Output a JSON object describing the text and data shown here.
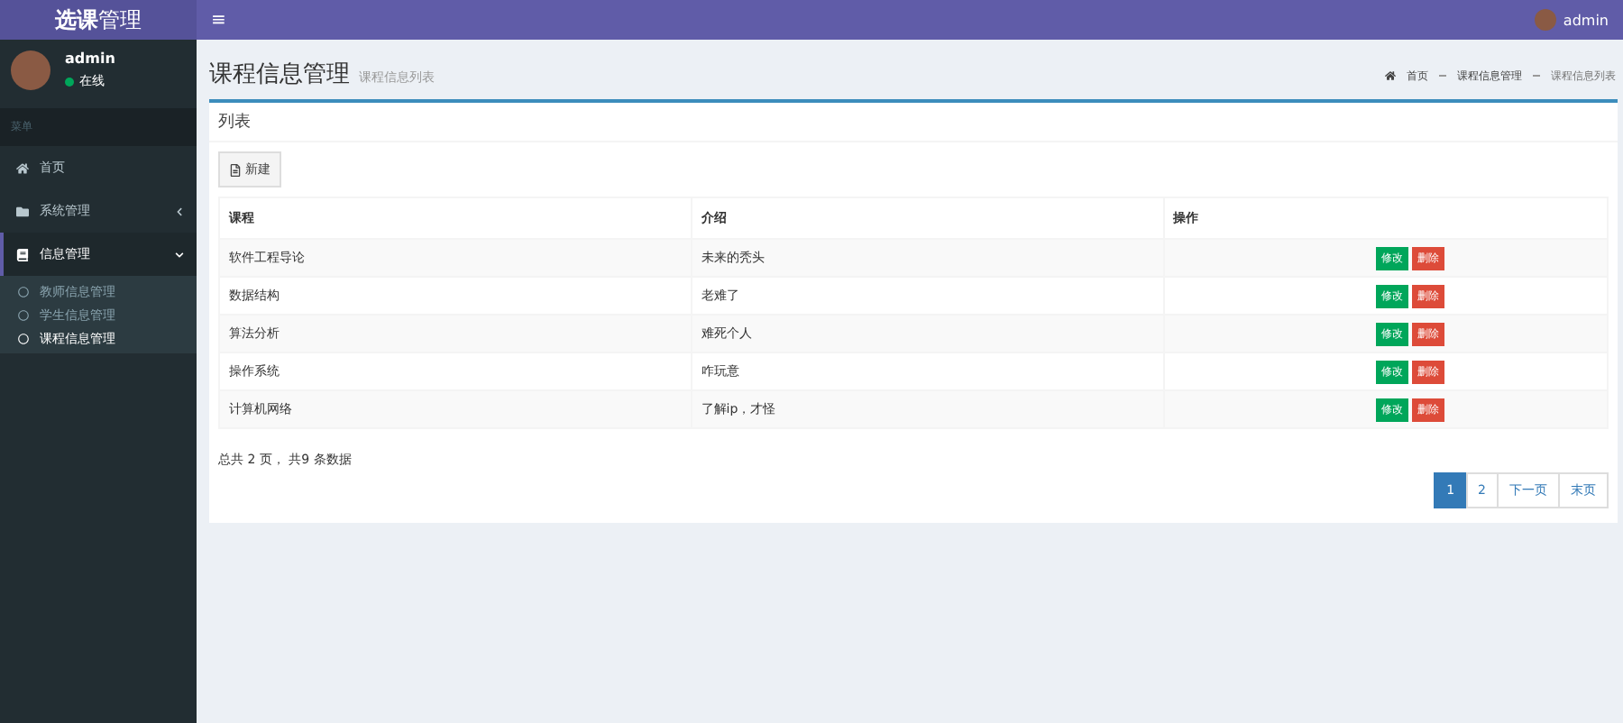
{
  "logo": {
    "bold": "选课",
    "rest": "管理"
  },
  "topbar": {
    "menu_toggle": "≡",
    "user": "admin"
  },
  "user_panel": {
    "name": "admin",
    "status": "在线",
    "online": true
  },
  "sidebar": {
    "header": "菜单",
    "items": [
      {
        "label": "首页",
        "kind": "link",
        "selected": false
      },
      {
        "label": "系统管理",
        "kind": "group",
        "expanded": false,
        "selected": false
      },
      {
        "label": "信息管理",
        "kind": "group",
        "expanded": true,
        "selected": true,
        "children": [
          {
            "label": "教师信息管理",
            "selected": false
          },
          {
            "label": "学生信息管理",
            "selected": false
          },
          {
            "label": "课程信息管理",
            "selected": true
          }
        ]
      }
    ]
  },
  "page": {
    "title": "课程信息管理",
    "subtitle": "课程信息列表",
    "breadcrumb": [
      "首页",
      "课程信息管理",
      "课程信息列表"
    ]
  },
  "card": {
    "title": "列表",
    "new_button": "新建",
    "table": {
      "columns": [
        "课程",
        "介绍",
        "操作"
      ],
      "rows": [
        {
          "course": "软件工程导论",
          "intro": "未来的秃头",
          "actions": [
            "修改",
            "删除"
          ]
        },
        {
          "course": "数据结构",
          "intro": "老难了",
          "actions": [
            "修改",
            "删除"
          ]
        },
        {
          "course": "算法分析",
          "intro": "难死个人",
          "actions": [
            "修改",
            "删除"
          ]
        },
        {
          "course": "操作系统",
          "intro": "咋玩意",
          "actions": [
            "修改",
            "删除"
          ]
        },
        {
          "course": "计算机网络",
          "intro": "了解ip，才怪",
          "actions": [
            "修改",
            "删除"
          ]
        }
      ]
    },
    "summary": "总共 2 页， 共9 条数据",
    "pagination": [
      {
        "label": "1",
        "selected": true
      },
      {
        "label": "2",
        "selected": false
      },
      {
        "label": "下一页",
        "selected": false
      },
      {
        "label": "末页",
        "selected": false
      }
    ]
  }
}
